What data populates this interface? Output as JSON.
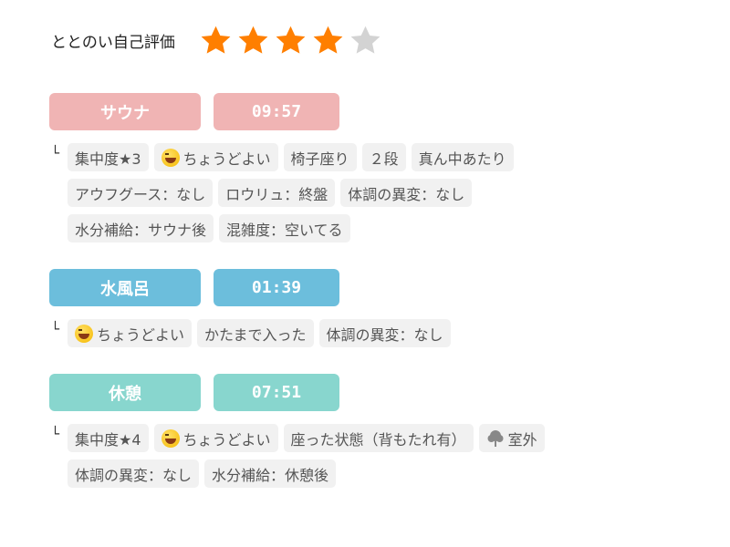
{
  "rating": {
    "label": "ととのい自己評価",
    "score": 4,
    "max": 5,
    "filled_color": "#ff7f00",
    "empty_color": "#d3d3d3"
  },
  "sections": [
    {
      "name": "サウナ",
      "time": "09:57",
      "color": "#f0b4b4",
      "tag_lines": [
        [
          "集中度★3",
          "ちょうどよい",
          "椅子座り",
          "２段",
          "真ん中あたり"
        ],
        [
          "アウフグース：なし",
          "ロウリュ：終盤",
          "体調の異変：なし"
        ],
        [
          "水分補給：サウナ後",
          "混雑度：空いてる"
        ]
      ]
    },
    {
      "name": "水風呂",
      "time": "01:39",
      "color": "#6cbedc",
      "tag_lines": [
        [
          "ちょうどよい",
          "かたまで入った",
          "体調の異変：なし"
        ]
      ]
    },
    {
      "name": "休憩",
      "time": "07:51",
      "color": "#88d6ce",
      "tag_lines": [
        [
          "集中度★4",
          "ちょうどよい",
          "座った状態（背もたれ有）",
          "室外"
        ],
        [
          "体調の異変：なし",
          "水分補給：休憩後"
        ]
      ]
    }
  ],
  "branch_symbol": "└",
  "icons": {
    "emoji_tag": "grinning-squint-emoji-icon",
    "outdoor_tag": "tree-icon",
    "star": "star-icon"
  }
}
